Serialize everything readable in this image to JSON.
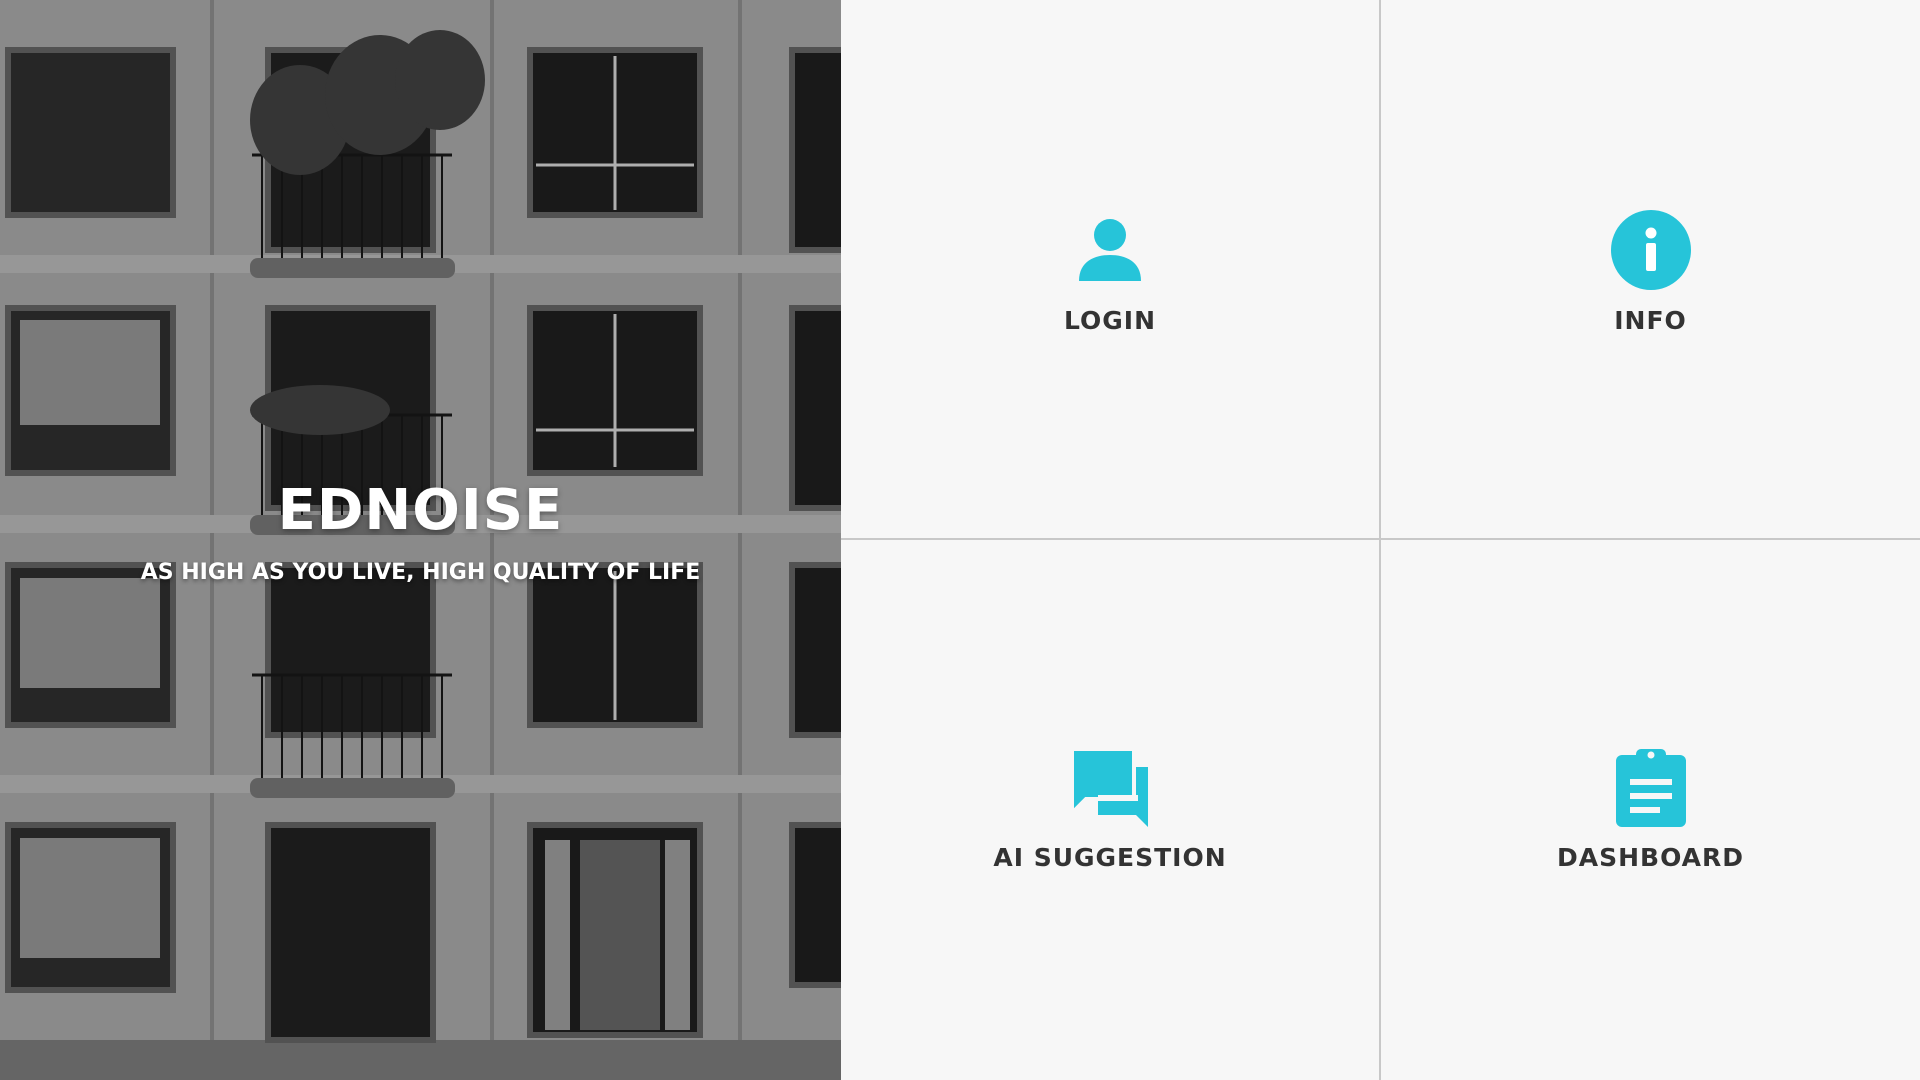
{
  "hero": {
    "title": "EDNOISE",
    "subtitle": "AS HIGH AS YOU LIVE, HIGH QUALITY OF LIFE",
    "image_description_icon": "building-balconies-photo"
  },
  "colors": {
    "accent": "#26c4d9",
    "label": "#333333",
    "background": "#f7f7f7",
    "divider": "#c8c8c8"
  },
  "tiles": [
    {
      "label": "LOGIN",
      "icon": "person-icon"
    },
    {
      "label": "INFO",
      "icon": "info-icon"
    },
    {
      "label": "AI SUGGESTION",
      "icon": "chat-bubbles-icon"
    },
    {
      "label": "DASHBOARD",
      "icon": "clipboard-icon"
    }
  ]
}
